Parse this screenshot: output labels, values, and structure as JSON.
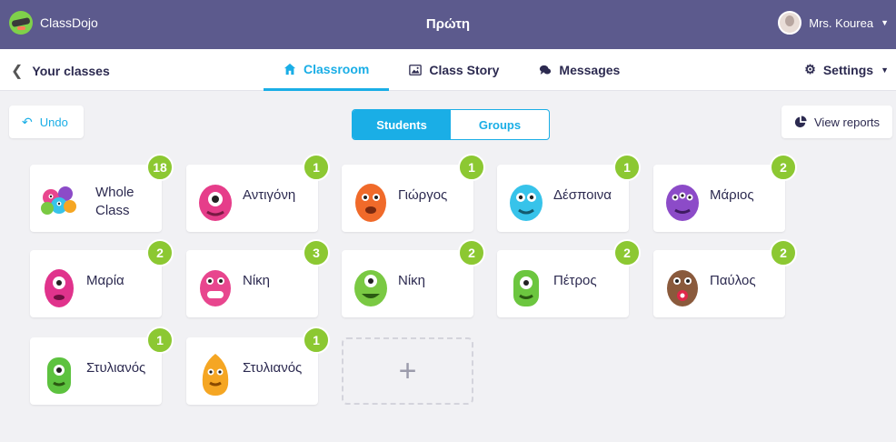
{
  "app": {
    "name": "ClassDojo",
    "page_title": "Πρώτη"
  },
  "user": {
    "name": "Mrs. Kourea"
  },
  "nav": {
    "back_label": "Your classes",
    "tabs": [
      {
        "label": "Classroom",
        "active": true,
        "icon": "home-icon"
      },
      {
        "label": "Class Story",
        "active": false,
        "icon": "image-icon"
      },
      {
        "label": "Messages",
        "active": false,
        "icon": "chat-icon"
      }
    ],
    "settings_label": "Settings"
  },
  "toolbar": {
    "undo_label": "Undo",
    "toggle": {
      "students": "Students",
      "groups": "Groups",
      "active": "Students"
    },
    "reports_label": "View reports"
  },
  "colors": {
    "topbar": "#5c5a8d",
    "accent": "#1aaee6",
    "badge": "#8cc832"
  },
  "whole_class": {
    "label": "Whole Class",
    "points": "18"
  },
  "students": [
    {
      "name": "Αντιγόνη",
      "points": "1",
      "color": "#e63d8a"
    },
    {
      "name": "Γιώργος",
      "points": "1",
      "color": "#f06a2a"
    },
    {
      "name": "Δέσποινα",
      "points": "1",
      "color": "#37c3ea"
    },
    {
      "name": "Μάριος",
      "points": "2",
      "color": "#8c4bc8"
    },
    {
      "name": "Μαρία",
      "points": "2",
      "color": "#e0338c"
    },
    {
      "name": "Νίκη",
      "points": "3",
      "color": "#e8468e"
    },
    {
      "name": "Νίκη",
      "points": "2",
      "color": "#7ac943"
    },
    {
      "name": "Πέτρος",
      "points": "2",
      "color": "#6cc63f"
    },
    {
      "name": "Παύλος",
      "points": "2",
      "color": "#8a5a3c"
    },
    {
      "name": "Στυλιανός",
      "points": "1",
      "color": "#5dc23f"
    },
    {
      "name": "Στυλιανός",
      "points": "1",
      "color": "#f5a623"
    }
  ],
  "add_card": {
    "icon": "plus-icon"
  }
}
